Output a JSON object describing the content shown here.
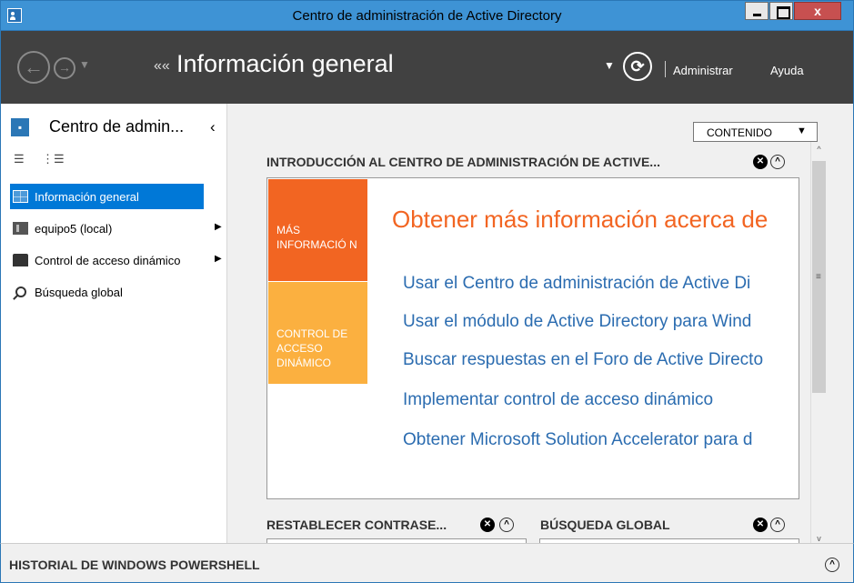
{
  "window": {
    "title": "Centro de administración de Active Directory",
    "close_label": "x"
  },
  "navbar": {
    "back_glyph": "←",
    "forward_glyph": "→",
    "chevrons": "««",
    "title": "Información general",
    "refresh_glyph": "⟳",
    "admin_label": "Administrar",
    "help_label": "Ayuda"
  },
  "leftpane": {
    "title": "Centro de admin...",
    "collapse_glyph": "‹",
    "items": [
      {
        "label": "Información general",
        "selected": true,
        "icon": "overview-icon",
        "has_arrow": false
      },
      {
        "label": "equipo5 (local)",
        "selected": false,
        "icon": "server-icon",
        "has_arrow": true
      },
      {
        "label": "Control de acceso dinámico",
        "selected": false,
        "icon": "folder-icon",
        "has_arrow": true
      },
      {
        "label": "Búsqueda global",
        "selected": false,
        "icon": "search-icon",
        "has_arrow": false
      }
    ]
  },
  "main": {
    "contenido_label": "CONTENIDO",
    "intro_section_title": "INTRODUCCIÓN AL CENTRO DE ADMINISTRACIÓN DE ACTIVE...",
    "tiles": [
      {
        "label": "MÁS INFORMACIÓ N",
        "color": "#f26522"
      },
      {
        "label": "CONTROL DE ACCESO DINÁMICO",
        "color": "#fbb040"
      }
    ],
    "intro_heading": "Obtener más información acerca de",
    "links": [
      "Usar el Centro de administración de Active Di",
      "Usar el módulo de Active Directory para Wind",
      "Buscar respuestas en el Foro de Active Directo",
      "Implementar control de acceso dinámico",
      "Obtener Microsoft Solution Accelerator para d"
    ],
    "reset_section_title": "RESTABLECER CONTRASE...",
    "search_section_title": "BÚSQUEDA GLOBAL"
  },
  "bottombar": {
    "title": "HISTORIAL DE WINDOWS POWERSHELL"
  },
  "colors": {
    "accent": "#3e93d5",
    "nav_bg": "#414141",
    "selected": "#0078d7",
    "link": "#2b6cb0",
    "heading_orange": "#f26522"
  }
}
